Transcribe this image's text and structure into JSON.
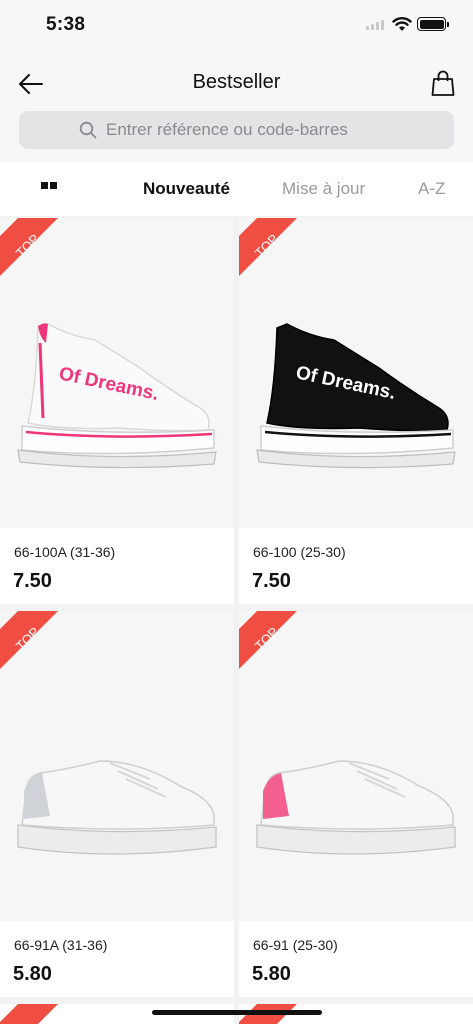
{
  "status_bar": {
    "time": "5:38"
  },
  "header": {
    "title": "Bestseller"
  },
  "search": {
    "placeholder": "Entrer référence ou code-barres"
  },
  "filters": {
    "tabs": [
      {
        "label": "Nouveauté",
        "active": true
      },
      {
        "label": "Mise à jour",
        "active": false
      },
      {
        "label": "A-Z",
        "active": false
      }
    ]
  },
  "products": [
    {
      "badge": "TOP",
      "name": "66-100A (31-36)",
      "price": "7.50",
      "image": "white-pink-sock-sneaker"
    },
    {
      "badge": "TOP",
      "name": "66-100 (25-30)",
      "price": "7.50",
      "image": "black-sock-sneaker"
    },
    {
      "badge": "TOP",
      "name": "66-91A (31-36)",
      "price": "5.80",
      "image": "white-silver-sneaker"
    },
    {
      "badge": "TOP",
      "name": "66-91 (25-30)",
      "price": "5.80",
      "image": "white-pink-sneaker"
    }
  ],
  "shoe_print": "Of Dreams.",
  "colors": {
    "badge": "#f04e43",
    "accent_pink": "#f0357a",
    "active_tab": "#111111",
    "inactive_tab": "#9a9a9a"
  }
}
